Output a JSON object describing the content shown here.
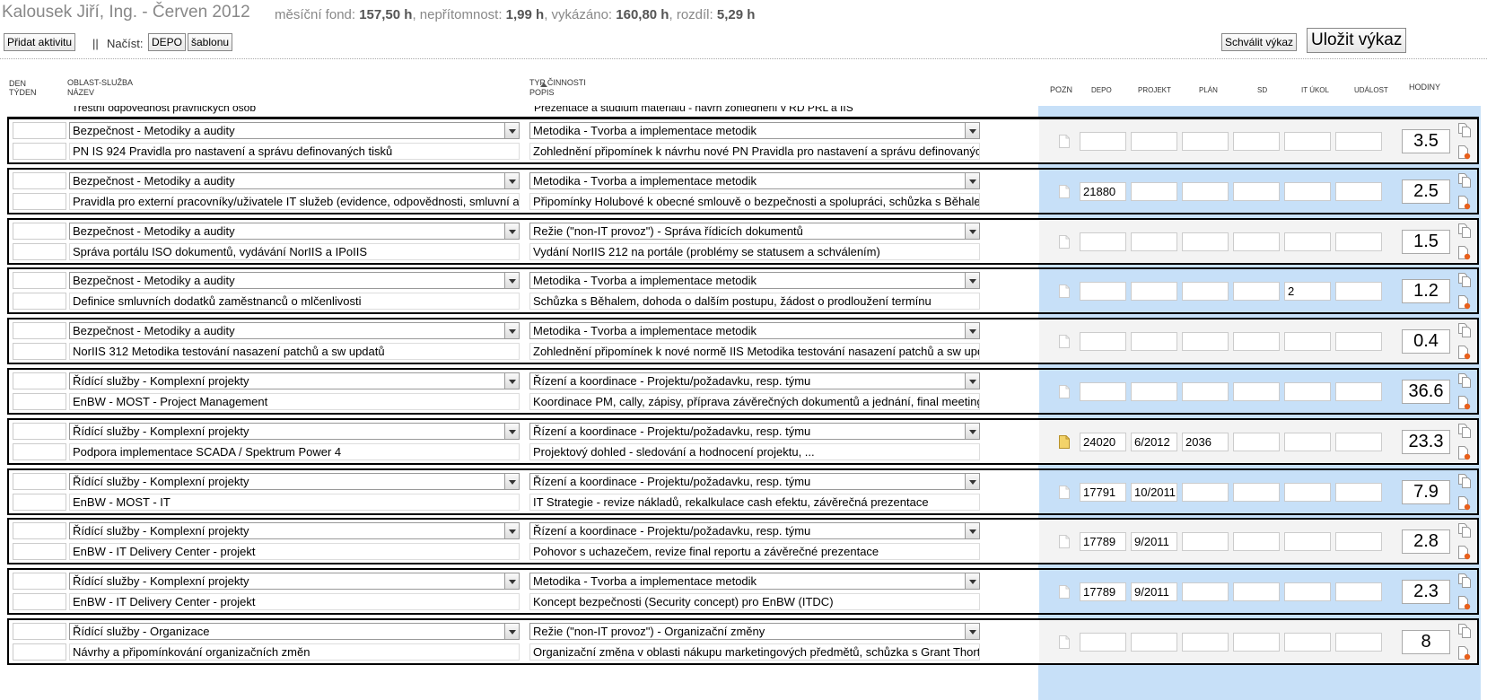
{
  "header": {
    "title": "Kalousek Jiří, Ing. - Červen 2012",
    "fond_label": "měsíční fond:",
    "fond_value": "157,50 h",
    "absence_label": "nepřítomnost:",
    "absence_value": "1,99 h",
    "reported_label": "vykázáno:",
    "reported_value": "160,80 h",
    "diff_label": "rozdíl:",
    "diff_value": "5,29 h"
  },
  "toolbar": {
    "add_activity": "Přidat aktivitu",
    "separator": "||",
    "load_label": "Načíst:",
    "depo": "DEPO",
    "template": "šablonu",
    "approve": "Schválit výkaz",
    "save": "Uložit výkaz"
  },
  "columns": {
    "den": "DEN",
    "tyden": "TÝDEN",
    "oblast": "OBLAST-SLUŽBA",
    "nazev": "NÁZEV",
    "typ": "TYP ČINNOSTI",
    "popis": "POPIS",
    "pozn": "POZN",
    "depo": "DEPO",
    "projekt": "PROJEKT",
    "plan": "PLÁN",
    "sd": "SD",
    "it_ukol": "IT ÚKOL",
    "udalost": "UDÁLOST",
    "hodiny": "HODINY"
  },
  "partial_row": {
    "name": "Trestní odpovědnost právnických osob",
    "desc": "Prezentace a studium materiálů - návrh zohlednění v RD PRL a IIS"
  },
  "rows": [
    {
      "area": "Bezpečnost - Metodiky a audity",
      "name": "PN IS 924 Pravidla pro nastavení a správu definovaných tisků",
      "type": "Metodika - Tvorba a implementace metodik",
      "desc": "Zohlednění připomínek k návrhu nové PN Pravidla pro nastavení a správu definovaných t",
      "depo": "",
      "projekt": "",
      "plan": "",
      "sd": "",
      "it": "",
      "udalost": "",
      "hours": "3.5",
      "note": false,
      "blue": false
    },
    {
      "area": "Bezpečnost - Metodiky a audity",
      "name": "Pravidla pro externí pracovníky/uživatele IT služeb (evidence, odpovědnosti, smluvní aspe",
      "type": "Metodika - Tvorba a implementace metodik",
      "desc": "Připomínky Holubové k obecné smlouvě o bezpečnosti a spolupráci, schůzka s Běhalem",
      "depo": "21880",
      "projekt": "",
      "plan": "",
      "sd": "",
      "it": "",
      "udalost": "",
      "hours": "2.5",
      "note": false,
      "blue": true
    },
    {
      "area": "Bezpečnost - Metodiky a audity",
      "name": "Správa portálu ISO dokumentů, vydávání NorIIS a IPoIIS",
      "type": "Režie (\"non-IT provoz\") - Správa řídicích dokumentů",
      "desc": "Vydání NorIIS 212 na portále (problémy se statusem a schválením)",
      "depo": "",
      "projekt": "",
      "plan": "",
      "sd": "",
      "it": "",
      "udalost": "",
      "hours": "1.5",
      "note": false,
      "blue": false
    },
    {
      "area": "Bezpečnost - Metodiky a audity",
      "name": "Definice smluvních dodatků zaměstnanců o mlčenlivosti",
      "type": "Metodika - Tvorba a implementace metodik",
      "desc": "Schůzka s Běhalem, dohoda o dalším postupu, žádost o prodloužení termínu",
      "depo": "",
      "projekt": "",
      "plan": "",
      "sd": "",
      "it": "2",
      "udalost": "",
      "hours": "1.2",
      "note": false,
      "blue": true
    },
    {
      "area": "Bezpečnost - Metodiky a audity",
      "name": "NorIIS 312 Metodika testování nasazení patchů a sw updatů",
      "type": "Metodika - Tvorba a implementace metodik",
      "desc": "Zohlednění připomínek k nové normě IIS Metodika testování nasazení patchů a sw updat",
      "depo": "",
      "projekt": "",
      "plan": "",
      "sd": "",
      "it": "",
      "udalost": "",
      "hours": "0.4",
      "note": false,
      "blue": false
    },
    {
      "area": "Řídící služby - Komplexní projekty",
      "name": "EnBW - MOST - Project Management",
      "type": "Řízení a koordinace - Projektu/požadavku, resp. týmu",
      "desc": "Koordinace PM, cally, zápisy, příprava závěrečných dokumentů a jednání, final meeting",
      "depo": "",
      "projekt": "",
      "plan": "",
      "sd": "",
      "it": "",
      "udalost": "",
      "hours": "36.6",
      "note": false,
      "blue": true
    },
    {
      "area": "Řídící služby - Komplexní projekty",
      "name": "Podpora implementace SCADA / Spektrum Power 4",
      "type": "Řízení a koordinace - Projektu/požadavku, resp. týmu",
      "desc": "Projektový dohled - sledování a hodnocení projektu, ...",
      "depo": "24020",
      "projekt": "6/2012",
      "plan": "2036",
      "sd": "",
      "it": "",
      "udalost": "",
      "hours": "23.3",
      "note": true,
      "blue": false
    },
    {
      "area": "Řídící služby - Komplexní projekty",
      "name": "EnBW - MOST - IT",
      "type": "Řízení a koordinace - Projektu/požadavku, resp. týmu",
      "desc": "IT Strategie - revize nákladů, rekalkulace cash efektu, závěrečná prezentace",
      "depo": "17791",
      "projekt": "10/2011",
      "plan": "",
      "sd": "",
      "it": "",
      "udalost": "",
      "hours": "7.9",
      "note": false,
      "blue": true
    },
    {
      "area": "Řídící služby - Komplexní projekty",
      "name": "EnBW - IT Delivery Center - projekt",
      "type": "Řízení a koordinace - Projektu/požadavku, resp. týmu",
      "desc": "Pohovor s uchazečem, revize final reportu a závěrečné prezentace",
      "depo": "17789",
      "projekt": "9/2011",
      "plan": "",
      "sd": "",
      "it": "",
      "udalost": "",
      "hours": "2.8",
      "note": false,
      "blue": false
    },
    {
      "area": "Řídící služby - Komplexní projekty",
      "name": "EnBW - IT Delivery Center - projekt",
      "type": "Metodika - Tvorba a implementace metodik",
      "desc": "Koncept bezpečnosti (Security concept) pro EnBW (ITDC)",
      "depo": "17789",
      "projekt": "9/2011",
      "plan": "",
      "sd": "",
      "it": "",
      "udalost": "",
      "hours": "2.3",
      "note": false,
      "blue": true
    },
    {
      "area": "Řídící služby - Organizace",
      "name": "Návrhy a připomínkování organizačních změn",
      "type": "Režie (\"non-IT provoz\") - Organizační změny",
      "desc": "Organizační změna v oblasti nákupu marketingových předmětů, schůzka s Grant Thorton",
      "depo": "",
      "projekt": "",
      "plan": "",
      "sd": "",
      "it": "",
      "udalost": "",
      "hours": "8",
      "note": false,
      "blue": false
    }
  ],
  "colors": {
    "blue_row": "#c7e0f8",
    "note_active": "#f3d36a"
  }
}
